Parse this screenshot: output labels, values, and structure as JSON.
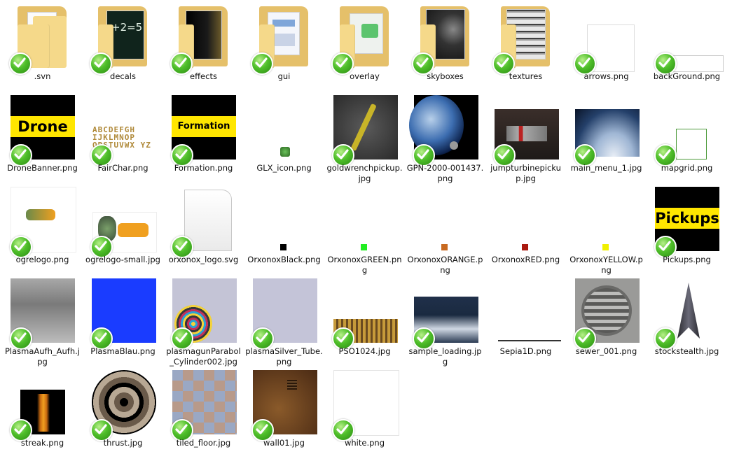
{
  "files": [
    {
      "name": ".svn",
      "kind": "folder",
      "preview": "none"
    },
    {
      "name": "decals",
      "kind": "folder",
      "preview": "chalk"
    },
    {
      "name": "effects",
      "kind": "folder",
      "preview": "dark"
    },
    {
      "name": "gui",
      "kind": "folder",
      "preview": "docs"
    },
    {
      "name": "overlay",
      "kind": "folder",
      "preview": "green"
    },
    {
      "name": "skyboxes",
      "kind": "folder",
      "preview": "space"
    },
    {
      "name": "textures",
      "kind": "folder",
      "preview": "metal"
    },
    {
      "name": "arrows.png",
      "kind": "image",
      "look": "white-box"
    },
    {
      "name": "backGround.png",
      "kind": "image",
      "look": "white-bar"
    },
    {
      "name": "DroneBanner.png",
      "kind": "image",
      "look": "banner",
      "text": "Drone",
      "fg": "#000000",
      "band": "#ffe600"
    },
    {
      "name": "FairChar.png",
      "kind": "image",
      "look": "font"
    },
    {
      "name": "Formation.png",
      "kind": "image",
      "look": "banner",
      "text": "Formation",
      "fg": "#000000",
      "band": "#ffe600"
    },
    {
      "name": "GLX_icon.png",
      "kind": "image",
      "look": "tiny-icon"
    },
    {
      "name": "goldwrenchpickup.jpg",
      "kind": "image",
      "look": "wrench"
    },
    {
      "name": "GPN-2000-001437.png",
      "kind": "image",
      "look": "earth"
    },
    {
      "name": "jumpturbinepickup.jpg",
      "kind": "image",
      "look": "turbine"
    },
    {
      "name": "main_menu_1.jpg",
      "kind": "image",
      "look": "planet"
    },
    {
      "name": "mapgrid.png",
      "kind": "image",
      "look": "grid"
    },
    {
      "name": "ogrelogo.png",
      "kind": "image",
      "look": "ogre-big"
    },
    {
      "name": "ogrelogo-small.jpg",
      "kind": "image",
      "look": "ogre-small"
    },
    {
      "name": "orxonox_logo.svg",
      "kind": "doc",
      "look": "page"
    },
    {
      "name": "OrxonoxBlack.png",
      "kind": "swatch",
      "color": "#000000"
    },
    {
      "name": "OrxonoxGREEN.png",
      "kind": "swatch",
      "color": "#22ee22"
    },
    {
      "name": "OrxonoxORANGE.png",
      "kind": "swatch",
      "color": "#c86a20"
    },
    {
      "name": "OrxonoxRED.png",
      "kind": "swatch",
      "color": "#aa1a10"
    },
    {
      "name": "OrxonoxYELLOW.png",
      "kind": "swatch",
      "color": "#f0f000"
    },
    {
      "name": "Pickups.png",
      "kind": "image",
      "look": "banner",
      "text": "Pickups",
      "fg": "#000000",
      "band": "#ffe600"
    },
    {
      "name": "PlasmaAufh_Aufh.jpg",
      "kind": "image",
      "look": "steel"
    },
    {
      "name": "PlasmaBlau.png",
      "kind": "image",
      "look": "blue"
    },
    {
      "name": "plasmagunParabol_Cylinder002.jpg",
      "kind": "image",
      "look": "spiral"
    },
    {
      "name": "plasmaSilver_Tube.png",
      "kind": "image",
      "look": "lavender"
    },
    {
      "name": "PSO1024.jpg",
      "kind": "image",
      "look": "bullets"
    },
    {
      "name": "sample_loading.jpg",
      "kind": "image",
      "look": "loading"
    },
    {
      "name": "Sepia1D.png",
      "kind": "image",
      "look": "line"
    },
    {
      "name": "sewer_001.png",
      "kind": "image",
      "look": "sewer"
    },
    {
      "name": "stockstealth.jpg",
      "kind": "image",
      "look": "jet"
    },
    {
      "name": "streak.png",
      "kind": "image",
      "look": "streak"
    },
    {
      "name": "thrust.jpg",
      "kind": "image",
      "look": "tunnel"
    },
    {
      "name": "tiled_floor.jpg",
      "kind": "image",
      "look": "tiles"
    },
    {
      "name": "wall01.jpg",
      "kind": "image",
      "look": "rust"
    },
    {
      "name": "white.png",
      "kind": "image",
      "look": "white-square"
    }
  ],
  "colors": {
    "folder": "#f5d98a",
    "folder_dark": "#e5c06a",
    "check": "#3ca51c"
  }
}
